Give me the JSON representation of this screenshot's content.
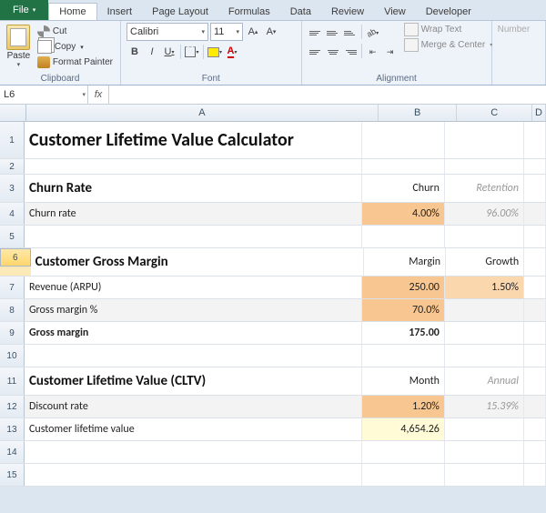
{
  "tabs": {
    "file": "File",
    "home": "Home",
    "insert": "Insert",
    "pagelayout": "Page Layout",
    "formulas": "Formulas",
    "data": "Data",
    "review": "Review",
    "view": "View",
    "developer": "Developer"
  },
  "clip": {
    "paste": "Paste",
    "cut": "Cut",
    "copy": "Copy",
    "fmt": "Format Painter",
    "title": "Clipboard"
  },
  "font": {
    "name": "Calibri",
    "size": "11",
    "title": "Font"
  },
  "align": {
    "wrap": "Wrap Text",
    "merge": "Merge & Center",
    "title": "Alignment"
  },
  "num": {
    "title": "Number"
  },
  "fx": {
    "namebox": "L6",
    "formula": ""
  },
  "cols": {
    "A": "A",
    "B": "B",
    "C": "C",
    "D": "D"
  },
  "rows": {
    "1": {
      "A": "Customer Lifetime Value Calculator"
    },
    "3": {
      "A": "Churn Rate",
      "B": "Churn",
      "C": "Retention"
    },
    "4": {
      "A": "Churn rate",
      "B": "4.00%",
      "C": "96.00%"
    },
    "6": {
      "A": "Customer Gross Margin",
      "B": "Margin",
      "C": "Growth"
    },
    "7": {
      "A": "Revenue (ARPU)",
      "B": "250.00",
      "C": "1.50%"
    },
    "8": {
      "A": "Gross margin %",
      "B": "70.0%"
    },
    "9": {
      "A": "Gross margin",
      "B": "175.00"
    },
    "11": {
      "A": "Customer Lifetime Value (CLTV)",
      "B": "Month",
      "C": "Annual"
    },
    "12": {
      "A": "Discount rate",
      "B": "1.20%",
      "C": "15.39%"
    },
    "13": {
      "A": "Customer lifetime value",
      "B": "4,654.26"
    }
  },
  "chart_data": {
    "type": "table",
    "title": "Customer Lifetime Value Calculator",
    "sections": [
      {
        "name": "Churn Rate",
        "columns": [
          "Churn",
          "Retention"
        ],
        "rows": [
          {
            "label": "Churn rate",
            "values": [
              "4.00%",
              "96.00%"
            ]
          }
        ]
      },
      {
        "name": "Customer Gross Margin",
        "columns": [
          "Margin",
          "Growth"
        ],
        "rows": [
          {
            "label": "Revenue (ARPU)",
            "values": [
              "250.00",
              "1.50%"
            ]
          },
          {
            "label": "Gross margin %",
            "values": [
              "70.0%",
              null
            ]
          },
          {
            "label": "Gross margin",
            "values": [
              "175.00",
              null
            ]
          }
        ]
      },
      {
        "name": "Customer Lifetime Value (CLTV)",
        "columns": [
          "Month",
          "Annual"
        ],
        "rows": [
          {
            "label": "Discount rate",
            "values": [
              "1.20%",
              "15.39%"
            ]
          },
          {
            "label": "Customer lifetime value",
            "values": [
              "4,654.26",
              null
            ]
          }
        ]
      }
    ]
  }
}
